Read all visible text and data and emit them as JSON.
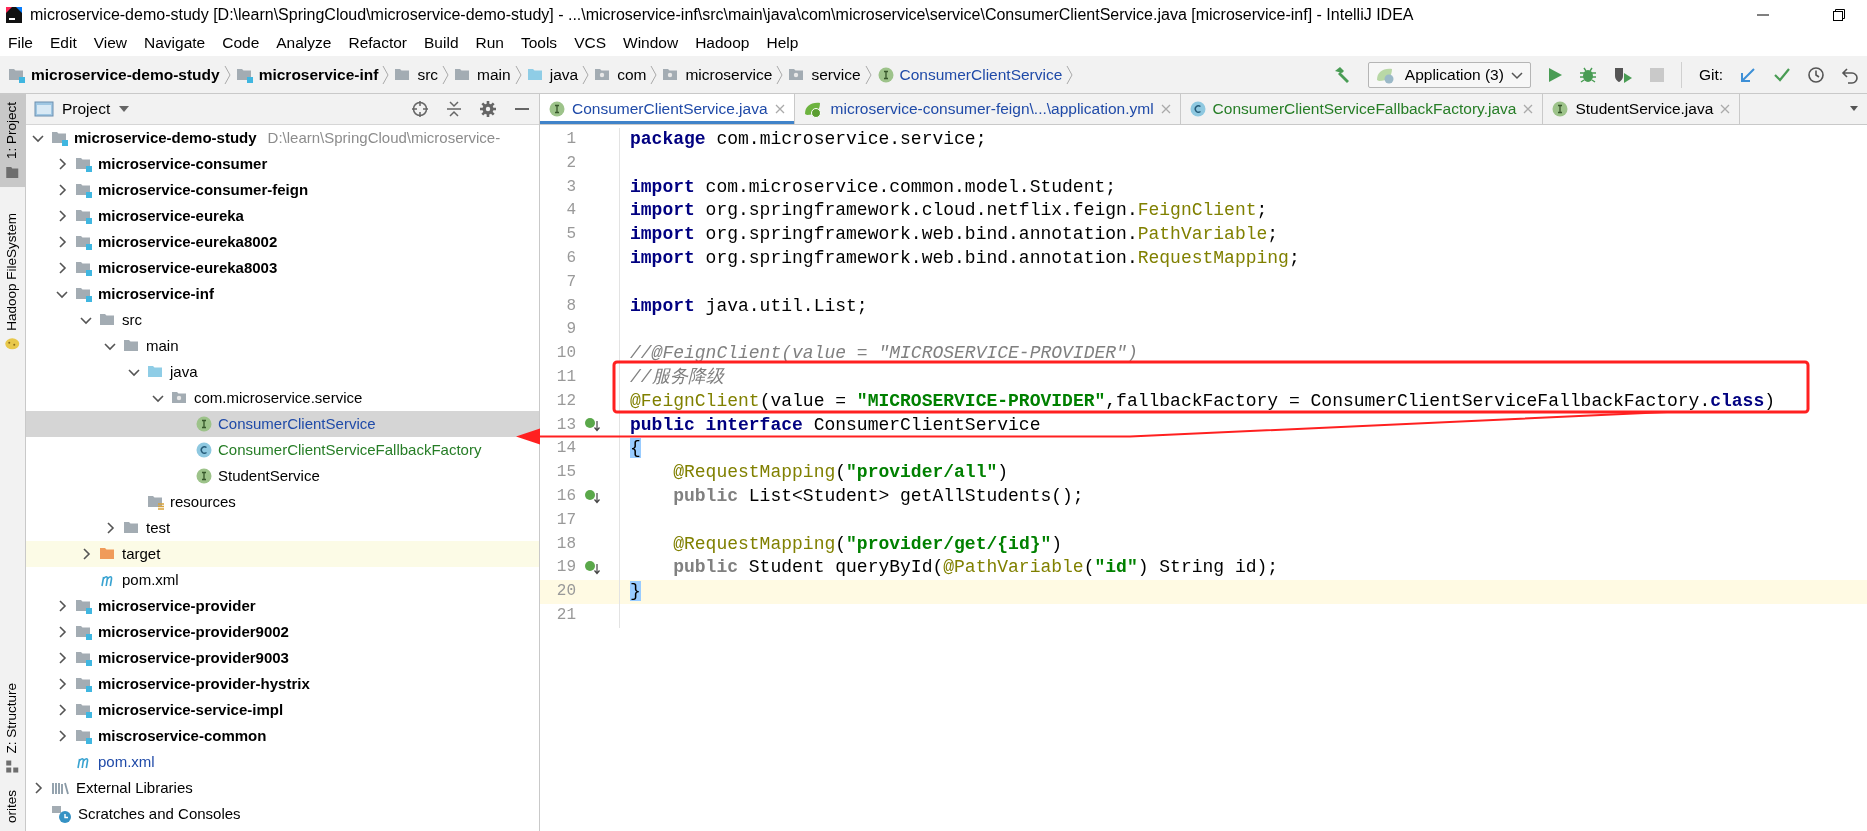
{
  "window": {
    "title": "microservice-demo-study [D:\\learn\\SpringCloud\\microservice-demo-study] - ...\\microservice-inf\\src\\main\\java\\com\\microservice\\service\\ConsumerClientService.java [microservice-inf] - IntelliJ IDEA"
  },
  "menu": [
    "File",
    "Edit",
    "View",
    "Navigate",
    "Code",
    "Analyze",
    "Refactor",
    "Build",
    "Run",
    "Tools",
    "VCS",
    "Window",
    "Hadoop",
    "Help"
  ],
  "breadcrumb": [
    {
      "label": "microservice-demo-study",
      "kind": "module"
    },
    {
      "label": "microservice-inf",
      "kind": "module"
    },
    {
      "label": "src",
      "kind": "folder"
    },
    {
      "label": "main",
      "kind": "folder"
    },
    {
      "label": "java",
      "kind": "source"
    },
    {
      "label": "com",
      "kind": "package"
    },
    {
      "label": "microservice",
      "kind": "package"
    },
    {
      "label": "service",
      "kind": "package"
    },
    {
      "label": "ConsumerClientService",
      "kind": "interface"
    }
  ],
  "toolbar": {
    "run_configuration": "Application (3)",
    "git_label": "Git:"
  },
  "tool_windows": [
    {
      "label": "1: Project",
      "kind": "project",
      "selected": true
    },
    {
      "label": "Hadoop FileSystem",
      "kind": "hadoop",
      "selected": false
    },
    {
      "label": "Z: Structure",
      "kind": "structure",
      "selected": false
    },
    {
      "label": "orites",
      "kind": "favorites",
      "selected": false
    }
  ],
  "project": {
    "title": "Project",
    "tree": [
      {
        "label": "microservice-demo-study",
        "path": "D:\\learn\\SpringCloud\\microservice-",
        "kind": "module",
        "expanded": true,
        "selected": false,
        "hovered": false,
        "children": [
          {
            "label": "microservice-consumer",
            "kind": "module",
            "expanded": false,
            "selected": false,
            "hovered": false
          },
          {
            "label": "microservice-consumer-feign",
            "kind": "module",
            "expanded": false,
            "selected": false,
            "hovered": false
          },
          {
            "label": "microservice-eureka",
            "kind": "module",
            "expanded": false,
            "selected": false,
            "hovered": false
          },
          {
            "label": "microservice-eureka8002",
            "kind": "module",
            "expanded": false,
            "selected": false,
            "hovered": false
          },
          {
            "label": "microservice-eureka8003",
            "kind": "module",
            "expanded": false,
            "selected": false,
            "hovered": false
          },
          {
            "label": "microservice-inf",
            "kind": "module",
            "expanded": true,
            "selected": false,
            "hovered": false,
            "children": [
              {
                "label": "src",
                "kind": "folder",
                "expanded": true,
                "selected": false,
                "hovered": false,
                "children": [
                  {
                    "label": "main",
                    "kind": "folder",
                    "expanded": true,
                    "selected": false,
                    "hovered": false,
                    "children": [
                      {
                        "label": "java",
                        "kind": "source",
                        "expanded": true,
                        "selected": false,
                        "hovered": false,
                        "children": [
                          {
                            "label": "com.microservice.service",
                            "kind": "package",
                            "expanded": true,
                            "selected": false,
                            "hovered": false,
                            "children": [
                              {
                                "label": "ConsumerClientService",
                                "kind": "interface",
                                "color": "#1f4aa8",
                                "selected": true,
                                "hovered": false
                              },
                              {
                                "label": "ConsumerClientServiceFallbackFactory",
                                "kind": "class",
                                "color": "#267d26",
                                "selected": false,
                                "hovered": false
                              },
                              {
                                "label": "StudentService",
                                "kind": "interface",
                                "color": "#000000",
                                "selected": false,
                                "hovered": false
                              }
                            ]
                          }
                        ]
                      },
                      {
                        "label": "resources",
                        "kind": "resources",
                        "selected": false,
                        "hovered": false
                      }
                    ]
                  },
                  {
                    "label": "test",
                    "kind": "folder",
                    "expanded": false,
                    "selected": false,
                    "hovered": false
                  }
                ]
              },
              {
                "label": "target",
                "kind": "excluded",
                "expanded": false,
                "selected": false,
                "hovered": true
              },
              {
                "label": "pom.xml",
                "kind": "maven",
                "color": "#000000",
                "selected": false,
                "hovered": false
              }
            ]
          },
          {
            "label": "microservice-provider",
            "kind": "module",
            "expanded": false,
            "selected": false,
            "hovered": false
          },
          {
            "label": "microservice-provider9002",
            "kind": "module",
            "expanded": false,
            "selected": false,
            "hovered": false
          },
          {
            "label": "microservice-provider9003",
            "kind": "module",
            "expanded": false,
            "selected": false,
            "hovered": false
          },
          {
            "label": "microservice-provider-hystrix",
            "kind": "module",
            "expanded": false,
            "selected": false,
            "hovered": false
          },
          {
            "label": "microservice-service-impl",
            "kind": "module",
            "expanded": false,
            "selected": false,
            "hovered": false
          },
          {
            "label": "miscroservice-common",
            "kind": "module",
            "expanded": false,
            "selected": false,
            "hovered": false
          },
          {
            "label": "pom.xml",
            "kind": "maven",
            "color": "#1f4aa8",
            "selected": false,
            "hovered": false
          }
        ]
      },
      {
        "label": "External Libraries",
        "kind": "libraries",
        "expanded": false,
        "selected": false,
        "hovered": false
      },
      {
        "label": "Scratches and Consoles",
        "kind": "scratches",
        "selected": false,
        "hovered": false
      }
    ]
  },
  "tabs": [
    {
      "label": "ConsumerClientService.java",
      "kind": "interface",
      "color": "#1f4aa8",
      "selected": true
    },
    {
      "label": "microservice-consumer-feign\\...\\application.yml",
      "kind": "yml",
      "color": "#1f4aa8",
      "selected": false
    },
    {
      "label": "ConsumerClientServiceFallbackFactory.java",
      "kind": "class",
      "color": "#267d26",
      "selected": false
    },
    {
      "label": "StudentService.java",
      "kind": "interface",
      "color": "#000000",
      "selected": false
    }
  ],
  "editor": {
    "lines": [
      {
        "number": "1",
        "current": false,
        "tokens": [
          {
            "text": "package",
            "kind": "keyword"
          },
          {
            "text": " com.microservice.service;",
            "kind": "plain"
          }
        ]
      },
      {
        "number": "2",
        "current": false
      },
      {
        "number": "3",
        "current": false,
        "tokens": [
          {
            "text": "import",
            "kind": "keyword"
          },
          {
            "text": " com.microservice.common.model.Student;",
            "kind": "plain"
          }
        ]
      },
      {
        "number": "4",
        "current": false,
        "tokens": [
          {
            "text": "import",
            "kind": "keyword"
          },
          {
            "text": " org.springframework.cloud.netflix.feign.",
            "kind": "plain"
          },
          {
            "text": "FeignClient",
            "kind": "annotation"
          },
          {
            "text": ";",
            "kind": "plain"
          }
        ]
      },
      {
        "number": "5",
        "current": false,
        "tokens": [
          {
            "text": "import",
            "kind": "keyword"
          },
          {
            "text": " org.springframework.web.bind.annotation.",
            "kind": "plain"
          },
          {
            "text": "PathVariable",
            "kind": "annotation"
          },
          {
            "text": ";",
            "kind": "plain"
          }
        ]
      },
      {
        "number": "6",
        "current": false,
        "tokens": [
          {
            "text": "import",
            "kind": "keyword"
          },
          {
            "text": " org.springframework.web.bind.annotation.",
            "kind": "plain"
          },
          {
            "text": "RequestMapping",
            "kind": "annotation"
          },
          {
            "text": ";",
            "kind": "plain"
          }
        ]
      },
      {
        "number": "7",
        "current": false
      },
      {
        "number": "8",
        "current": false,
        "tokens": [
          {
            "text": "import",
            "kind": "keyword"
          },
          {
            "text": " java.util.List;",
            "kind": "plain"
          }
        ]
      },
      {
        "number": "9",
        "current": false
      },
      {
        "number": "10",
        "current": false,
        "tokens": [
          {
            "text": "//@FeignClient(value = \"MICROSERVICE-PROVIDER\")",
            "kind": "comment"
          }
        ]
      },
      {
        "number": "11",
        "current": false,
        "tokens": [
          {
            "text": "//服务降级",
            "kind": "comment"
          }
        ]
      },
      {
        "number": "12",
        "current": false,
        "tokens": [
          {
            "text": "@FeignClient",
            "kind": "annotation"
          },
          {
            "text": "(value = ",
            "kind": "plain"
          },
          {
            "text": "\"MICROSERVICE-PROVIDER\"",
            "kind": "string"
          },
          {
            "text": ",fallbackFactory = ConsumerClientServiceFallbackFactory.",
            "kind": "plain"
          },
          {
            "text": "class",
            "kind": "keyword"
          },
          {
            "text": ")",
            "kind": "plain"
          }
        ]
      },
      {
        "number": "13",
        "current": false,
        "implemented": true,
        "tokens": [
          {
            "text": "public interface",
            "kind": "keyword"
          },
          {
            "text": " ConsumerClientService",
            "kind": "plain"
          }
        ]
      },
      {
        "number": "14",
        "current": false,
        "tokens": [
          {
            "text": "{",
            "kind": "brace"
          }
        ]
      },
      {
        "number": "15",
        "current": false,
        "indented": true,
        "tokens": [
          {
            "text": "@RequestMapping",
            "kind": "annotation"
          },
          {
            "text": "(",
            "kind": "plain"
          },
          {
            "text": "\"provider/all\"",
            "kind": "string"
          },
          {
            "text": ")",
            "kind": "plain"
          }
        ]
      },
      {
        "number": "16",
        "current": false,
        "indented": true,
        "implemented": true,
        "tokens": [
          {
            "text": "public",
            "kind": "redundant"
          },
          {
            "text": " List<Student> getAllStudents();",
            "kind": "plain"
          }
        ]
      },
      {
        "number": "17",
        "current": false
      },
      {
        "number": "18",
        "current": false,
        "indented": true,
        "tokens": [
          {
            "text": "@RequestMapping",
            "kind": "annotation"
          },
          {
            "text": "(",
            "kind": "plain"
          },
          {
            "text": "\"provider/get/{id}\"",
            "kind": "string"
          },
          {
            "text": ")",
            "kind": "plain"
          }
        ]
      },
      {
        "number": "19",
        "current": false,
        "indented": true,
        "implemented": true,
        "tokens": [
          {
            "text": "public",
            "kind": "redundant"
          },
          {
            "text": " Student queryById(",
            "kind": "plain"
          },
          {
            "text": "@PathVariable",
            "kind": "annotation"
          },
          {
            "text": "(",
            "kind": "plain"
          },
          {
            "text": "\"id\"",
            "kind": "string"
          },
          {
            "text": ") String id);",
            "kind": "plain"
          }
        ]
      },
      {
        "number": "20",
        "current": true,
        "tokens": [
          {
            "text": "}",
            "kind": "brace"
          }
        ]
      },
      {
        "number": "21",
        "current": false
      }
    ]
  },
  "annotations": [
    {
      "kind": "box"
    },
    {
      "kind": "arrow"
    }
  ]
}
